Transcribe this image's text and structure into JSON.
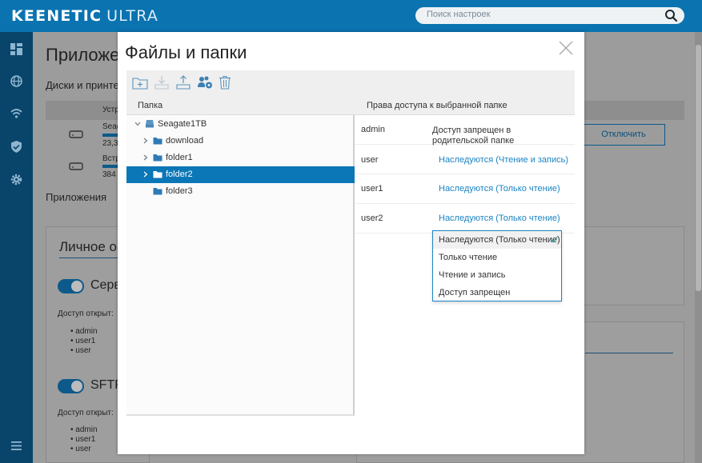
{
  "header": {
    "brand": "KEENETIC",
    "model": "ULTRA",
    "search_placeholder": "Поиск настроек"
  },
  "background": {
    "page_title": "Приложе",
    "section_disks": "Диски и принте",
    "col_device": "Устр",
    "disk1_name": "Seag",
    "disk1_size": "23,3",
    "disk2_name": "Встр",
    "disk2_size": "384",
    "disconnect_button": "Отключить",
    "section_apps": "Приложения",
    "personal_card_title": "Личное о",
    "service1_label": "Серв",
    "access_open_label": "Доступ открыт:",
    "service1_users": [
      "admin",
      "user1",
      "user"
    ],
    "service2_label": "SFTP",
    "service2_users": [
      "admin",
      "user1",
      "user"
    ]
  },
  "modal": {
    "title": "Файлы и папки",
    "folder_column": "Папка",
    "rights_column": "Права доступа к выбранной папке",
    "tree": [
      {
        "label": "Seagate1TB",
        "type": "drive",
        "expanded": true,
        "selected": false
      },
      {
        "label": "download",
        "type": "folder",
        "expandable": true,
        "selected": false
      },
      {
        "label": "folder1",
        "type": "folder",
        "expandable": true,
        "selected": false
      },
      {
        "label": "folder2",
        "type": "folder",
        "expandable": true,
        "selected": true
      },
      {
        "label": "folder3",
        "type": "folder",
        "expandable": false,
        "selected": false
      }
    ],
    "permissions": [
      {
        "user": "admin",
        "value": "Доступ запрещен в родительской папке",
        "style": "plain"
      },
      {
        "user": "user",
        "value": "Наследуются (Чтение и запись)",
        "style": "link"
      },
      {
        "user": "user1",
        "value": "Наследуются (Только чтение)",
        "style": "link"
      },
      {
        "user": "user2",
        "value": "Наследуются (Только чтение)",
        "style": "link"
      }
    ],
    "dropdown_options": [
      {
        "label": "Наследуются (Только чтение)",
        "checked": true
      },
      {
        "label": "Только чтение",
        "checked": false
      },
      {
        "label": "Чтение и запись",
        "checked": false
      },
      {
        "label": "Доступ запрещен",
        "checked": false
      }
    ]
  },
  "colors": {
    "topbar": "#0a73b0",
    "sidebar": "#09446b",
    "selection": "#0b77b7",
    "link": "#1b84c3"
  }
}
